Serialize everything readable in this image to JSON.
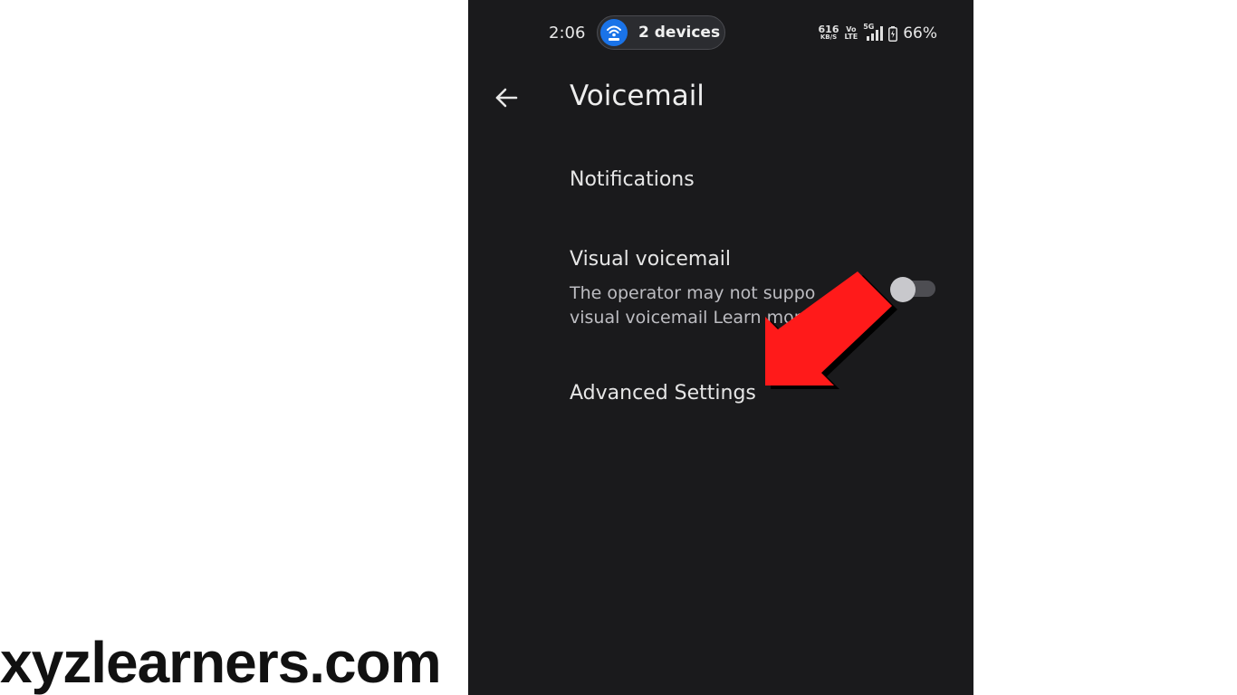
{
  "watermark": "xyzlearners.com",
  "status_bar": {
    "time": "2:06",
    "devices_chip": "2 devices",
    "net_speed_value": "616",
    "net_speed_unit": "KB/S",
    "volte_top": "Vo",
    "volte_bottom": "LTE",
    "network_type": "5G",
    "battery": "66%"
  },
  "header": {
    "title": "Voicemail"
  },
  "settings": {
    "notifications": "Notifications",
    "visual_voicemail": {
      "label": "Visual voicemail",
      "description_line1": "The operator may not suppo",
      "description_line2": "visual voicemail Learn more",
      "enabled": false
    },
    "advanced": "Advanced Settings"
  },
  "colors": {
    "background": "#1a1a1c",
    "annotation_arrow": "#ff1a1a",
    "chip_icon": "#1a73e8"
  },
  "icons": {
    "back": "arrow-left-icon",
    "devices": "hotspot-icon",
    "annotation": "red-arrow-icon"
  }
}
